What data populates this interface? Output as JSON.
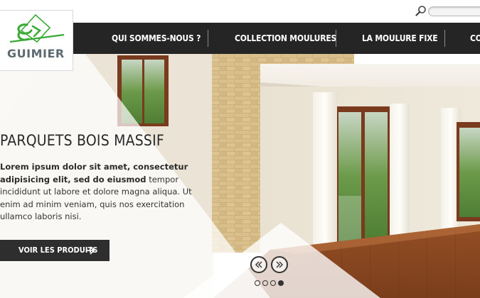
{
  "search": {
    "placeholder": ""
  },
  "logo": {
    "text": "GUIMIER"
  },
  "nav": {
    "items": [
      {
        "label": "QUI SOMMES-NOUS ?"
      },
      {
        "label": "COLLECTION MOULURES"
      },
      {
        "label": "LA MOULURE FIXE"
      },
      {
        "label": "CO"
      }
    ]
  },
  "hero": {
    "title": "PARQUETS BOIS MASSIF",
    "text_bold": "Lorem ipsum dolor sit amet, consectetur adipisicing elit, sed do eiusmod",
    "text_rest": " tempor incididunt ut labore et dolore magna aliqua. Ut enim ad minim veniam, quis nos exercitation ullamco laboris nisi.",
    "cta_label": "VOIR LES PRODUITS"
  },
  "slider": {
    "slide_count": 4,
    "active_index": 3
  },
  "colors": {
    "nav_bg": "#252525",
    "accent_green": "#3aa935",
    "cta_bg": "#2e2e2e"
  },
  "icons": {
    "search": "magnifier-icon",
    "cta": "arrow-right-icon",
    "prev": "chevron-left-icon",
    "next": "chevron-right-icon"
  }
}
